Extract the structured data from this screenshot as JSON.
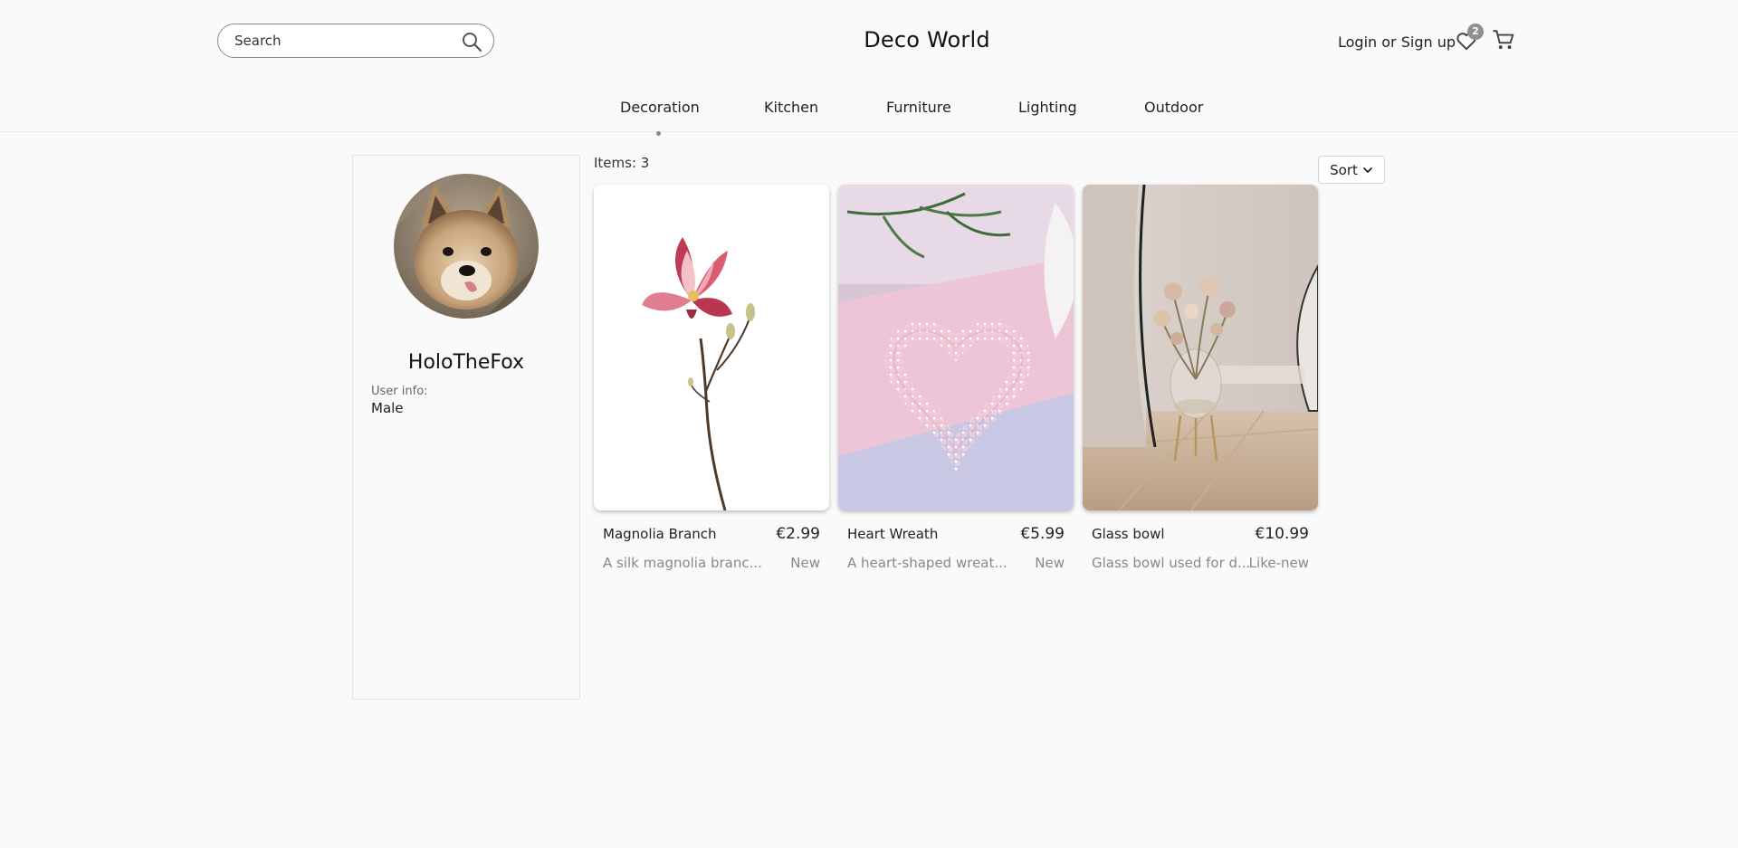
{
  "header": {
    "search_placeholder": "Search",
    "brand": "Deco World",
    "login_label": "Login",
    "or_label": "or",
    "signup_label": "Sign up",
    "wishlist_count": "2"
  },
  "nav": {
    "items": [
      {
        "label": "Decoration"
      },
      {
        "label": "Kitchen"
      },
      {
        "label": "Furniture"
      },
      {
        "label": "Lighting"
      },
      {
        "label": "Outdoor"
      }
    ],
    "active_index": 0
  },
  "profile": {
    "username": "HoloTheFox",
    "info_label": "User info:",
    "info_value": "Male"
  },
  "items": {
    "count_label": "Items: 3",
    "sort_label": "Sort",
    "cards": [
      {
        "name": "Magnolia Branch",
        "price": "€2.99",
        "description": "A silk magnolia branc...",
        "condition": "New"
      },
      {
        "name": "Heart Wreath",
        "price": "€5.99",
        "description": "A heart-shaped wreat...",
        "condition": "New"
      },
      {
        "name": "Glass bowl",
        "price": "€10.99",
        "description": "Glass bowl used for d...",
        "condition": "Like-new"
      }
    ]
  },
  "colors": {
    "background": "#fafafa",
    "text": "#222222",
    "muted_text": "#888888",
    "badge": "#8f8f8f"
  }
}
